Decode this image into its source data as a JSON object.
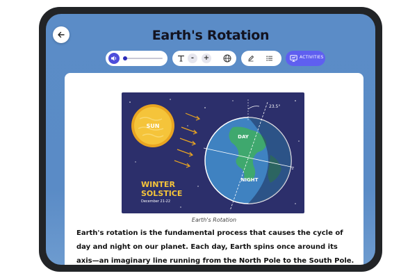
{
  "page": {
    "title": "Earth's Rotation"
  },
  "toolbar": {
    "activities_label": "ACTIVITIES",
    "minus_label": "-",
    "plus_label": "+"
  },
  "audio": {
    "progress": 0.0
  },
  "illustration": {
    "sun_label": "SUN",
    "day_label": "DAY",
    "night_label": "NIGHT",
    "tilt_label": "23.5°",
    "season_title_line1": "WINTER",
    "season_title_line2": "SOLSTICE",
    "season_date": "December 21-22"
  },
  "article": {
    "caption": "Earth's Rotation",
    "body": "Earth's rotation is the fundamental process that causes the cycle of day and night on our planet. Each day, Earth spins once around its axis—an imaginary line running from the North Pole to the South Pole. This spinning motion not only"
  },
  "colors": {
    "accent": "#5f5ff0",
    "background": "#5b8cc7",
    "illustration_bg": "#2c2f6b",
    "sun": "#f5c43a"
  }
}
